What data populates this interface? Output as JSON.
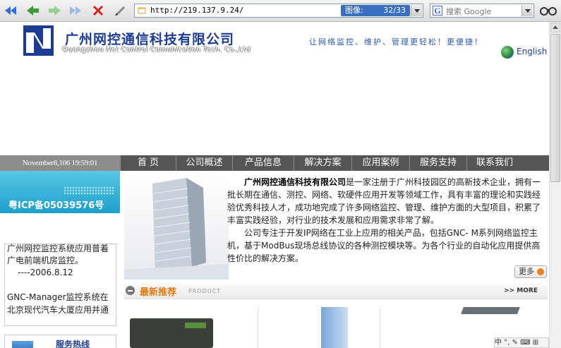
{
  "toolbar": {
    "url": "http://219.137.9.24/",
    "image_counter_label": "图像:",
    "image_counter_value": "32/33",
    "search_placeholder": "搜索 Google"
  },
  "header": {
    "company_name": "广州网控通信科技有限公司",
    "company_name_en": "Guangzhou Net Control Comunication Tech. Co.,Ltd",
    "slogan": "让网络监控、维护、管理更轻松！更便捷！",
    "language_link": "English"
  },
  "nav": {
    "datetime": "November8,106 19:59:01",
    "items": [
      "首 页",
      "公司概述",
      "产品信息",
      "解决方案",
      "应用案例",
      "服务支持",
      "联系我们"
    ]
  },
  "sidebar": {
    "icp": "粤ICP备05039576号",
    "news_lines": [
      "广州网控监控系统应用普着",
      "广电前端机房监控。",
      "    ----2006.8.12",
      "",
      "GNC-Manager监控系统在",
      "北京现代汽车大厦应用并通"
    ],
    "hotline_title": "服务热线"
  },
  "intro": {
    "company_bold": "广州网控通信科技有限公司",
    "para1_rest": "是一家注册于广州科技园区的高新技术企业，拥有一批长期在通信、测控、网络、软硬件应用开发等领域工作，具有丰富的理论和实践经验优秀科技人才，成功地完成了许多网络监控、管理、维护方面的大型项目，积累了丰富实践经验，对行业的技术发展和应用需求非常了解。",
    "para2": "公司专注于开发IP网络在工业上应用的相关产品，包括GNC- M系列网络监控主机，基于ModBus现场总线协议的各种测控模块等。为各个行业的自动化应用提供高性价比的解决方案。",
    "more_label": "更多"
  },
  "recommend": {
    "title": "最新推荐",
    "subtitle": "PRODUCT",
    "more_label": ">> MORE"
  },
  "ime_bar": "中 °, ✎ ⌨ ⊞"
}
